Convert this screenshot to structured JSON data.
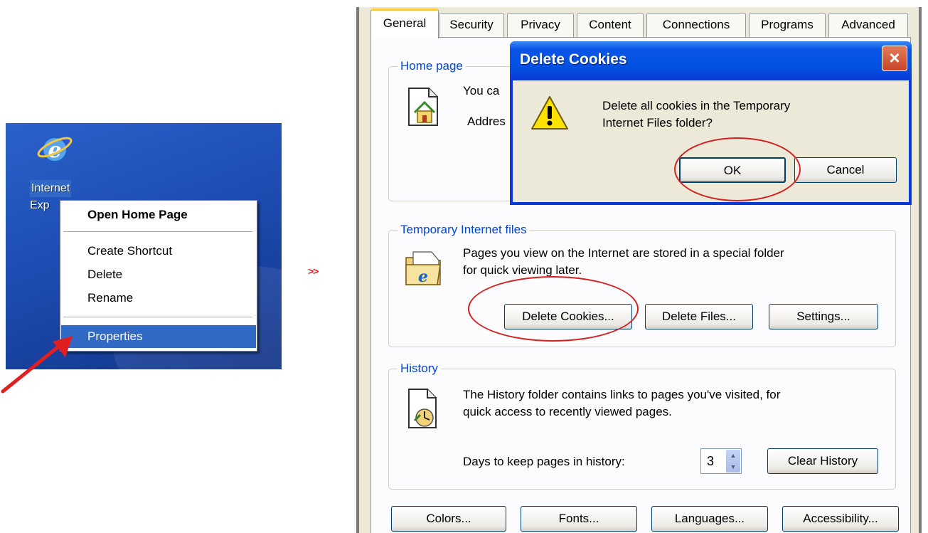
{
  "desktop": {
    "icon_label_line1": "Internet",
    "icon_label_line2": "Exp",
    "context_menu": {
      "open_home_page": "Open Home Page",
      "create_shortcut": "Create Shortcut",
      "delete": "Delete",
      "rename": "Rename",
      "properties": "Properties"
    }
  },
  "flow_arrow": ">>",
  "internet_options": {
    "tabs": [
      "General",
      "Security",
      "Privacy",
      "Content",
      "Connections",
      "Programs",
      "Advanced"
    ],
    "active_tab": "General",
    "home_page": {
      "title": "Home page",
      "text_partial": "You ca",
      "address_partial": "Addres"
    },
    "temp_files": {
      "title": "Temporary Internet files",
      "description_line1": "Pages you view on the Internet are stored in a special folder",
      "description_line2": "for quick viewing later.",
      "delete_cookies": "Delete Cookies...",
      "delete_files": "Delete Files...",
      "settings": "Settings..."
    },
    "history": {
      "title": "History",
      "description_line1": "The History folder contains links to pages you've visited, for",
      "description_line2": "quick access to recently viewed pages.",
      "days_label": "Days to keep pages in history:",
      "days_value": "3",
      "clear_history": "Clear History"
    },
    "bottom_buttons": {
      "colors": "Colors...",
      "fonts": "Fonts...",
      "languages": "Languages...",
      "accessibility": "Accessibility..."
    }
  },
  "delete_cookies_dialog": {
    "title": "Delete Cookies",
    "close": "×",
    "message_line1": "Delete all cookies in the Temporary",
    "message_line2": "Internet Files folder?",
    "ok": "OK",
    "cancel": "Cancel"
  },
  "colors": {
    "accent_red": "#d42020",
    "xp_blue": "#0a3ad6",
    "group_title_blue": "#0046d5",
    "selection_blue": "#316ac5"
  }
}
